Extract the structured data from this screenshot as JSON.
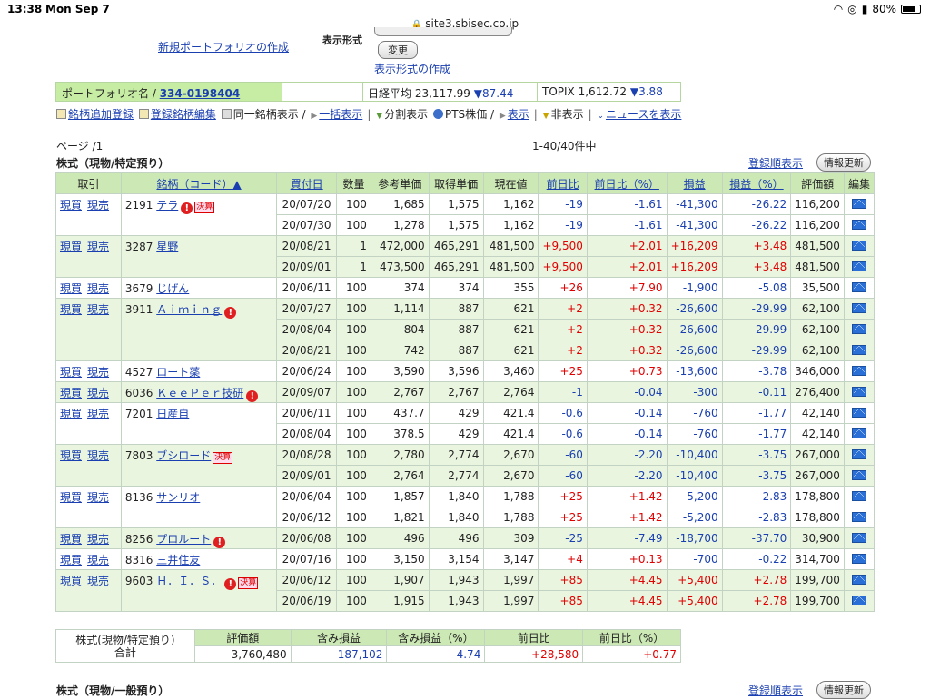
{
  "status": {
    "time": "13:38",
    "date": "Mon Sep 7",
    "battery": "80%",
    "url": "site3.sbisec.co.jp"
  },
  "top": {
    "new_portfolio": "新規ポートフォリオの作成",
    "display_format_label": "表示形式",
    "change_button": "変更",
    "create_format": "表示形式の作成"
  },
  "portfolio": {
    "label": "ポートフォリオ名 /",
    "id": "334-0198404",
    "nikkei_label": "日経平均",
    "nikkei_value": "23,117.99",
    "nikkei_change": "▼87.44",
    "topix_label": "TOPIX",
    "topix_value": "1,612.72",
    "topix_change": "▼3.88"
  },
  "links": {
    "add": "銘柄追加登録",
    "edit": "登録銘柄編集",
    "same_one": "同一銘柄表示 /",
    "bulk": "一括表示",
    "split": "分割表示",
    "pts": "PTS株価 /",
    "show": "表示",
    "hide": "非表示",
    "news": "ニュースを表示"
  },
  "page": {
    "label": "ページ /1",
    "count": "1-40/40件中"
  },
  "section1": {
    "title": "株式（現物/特定預り）",
    "order_link": "登録順表示",
    "refresh": "情報更新"
  },
  "section2": {
    "title": "株式（現物/一般預り）",
    "order_link": "登録順表示",
    "refresh": "情報更新"
  },
  "table": {
    "headers": [
      "取引",
      "銘柄（コード）▲",
      "買付日",
      "数量",
      "参考単価",
      "取得単価",
      "現在値",
      "前日比",
      "前日比（%）",
      "損益",
      "損益（%）",
      "評価額",
      "編集"
    ],
    "buy": "現買",
    "sell": "現売",
    "rows": [
      {
        "code": "2191",
        "name": "テラ",
        "warn": true,
        "kessan": true,
        "lots": [
          [
            "20/07/20",
            "100",
            "1,685",
            "1,575",
            "1,162",
            "-19",
            "-1.61",
            "-41,300",
            "-26.22",
            "116,200"
          ],
          [
            "20/07/30",
            "100",
            "1,278",
            "1,575",
            "1,162",
            "-19",
            "-1.61",
            "-41,300",
            "-26.22",
            "116,200"
          ]
        ]
      },
      {
        "code": "3287",
        "name": "星野",
        "warn": false,
        "kessan": false,
        "lots": [
          [
            "20/08/21",
            "1",
            "472,000",
            "465,291",
            "481,500",
            "+9,500",
            "+2.01",
            "+16,209",
            "+3.48",
            "481,500"
          ],
          [
            "20/09/01",
            "1",
            "473,500",
            "465,291",
            "481,500",
            "+9,500",
            "+2.01",
            "+16,209",
            "+3.48",
            "481,500"
          ]
        ]
      },
      {
        "code": "3679",
        "name": "じげん",
        "warn": false,
        "kessan": false,
        "lots": [
          [
            "20/06/11",
            "100",
            "374",
            "374",
            "355",
            "+26",
            "+7.90",
            "-1,900",
            "-5.08",
            "35,500"
          ]
        ]
      },
      {
        "code": "3911",
        "name": "Ａｉｍｉｎｇ",
        "warn": true,
        "kessan": false,
        "lots": [
          [
            "20/07/27",
            "100",
            "1,114",
            "887",
            "621",
            "+2",
            "+0.32",
            "-26,600",
            "-29.99",
            "62,100"
          ],
          [
            "20/08/04",
            "100",
            "804",
            "887",
            "621",
            "+2",
            "+0.32",
            "-26,600",
            "-29.99",
            "62,100"
          ],
          [
            "20/08/21",
            "100",
            "742",
            "887",
            "621",
            "+2",
            "+0.32",
            "-26,600",
            "-29.99",
            "62,100"
          ]
        ]
      },
      {
        "code": "4527",
        "name": "ロート薬",
        "warn": false,
        "kessan": false,
        "lots": [
          [
            "20/06/24",
            "100",
            "3,590",
            "3,596",
            "3,460",
            "+25",
            "+0.73",
            "-13,600",
            "-3.78",
            "346,000"
          ]
        ]
      },
      {
        "code": "6036",
        "name": "ＫｅｅＰｅｒ技研",
        "warn": true,
        "kessan": false,
        "lots": [
          [
            "20/09/07",
            "100",
            "2,767",
            "2,767",
            "2,764",
            "-1",
            "-0.04",
            "-300",
            "-0.11",
            "276,400"
          ]
        ]
      },
      {
        "code": "7201",
        "name": "日産自",
        "warn": false,
        "kessan": false,
        "lots": [
          [
            "20/06/11",
            "100",
            "437.7",
            "429",
            "421.4",
            "-0.6",
            "-0.14",
            "-760",
            "-1.77",
            "42,140"
          ],
          [
            "20/08/04",
            "100",
            "378.5",
            "429",
            "421.4",
            "-0.6",
            "-0.14",
            "-760",
            "-1.77",
            "42,140"
          ]
        ]
      },
      {
        "code": "7803",
        "name": "ブシロード",
        "warn": false,
        "kessan": true,
        "lots": [
          [
            "20/08/28",
            "100",
            "2,780",
            "2,774",
            "2,670",
            "-60",
            "-2.20",
            "-10,400",
            "-3.75",
            "267,000"
          ],
          [
            "20/09/01",
            "100",
            "2,764",
            "2,774",
            "2,670",
            "-60",
            "-2.20",
            "-10,400",
            "-3.75",
            "267,000"
          ]
        ]
      },
      {
        "code": "8136",
        "name": "サンリオ",
        "warn": false,
        "kessan": false,
        "lots": [
          [
            "20/06/04",
            "100",
            "1,857",
            "1,840",
            "1,788",
            "+25",
            "+1.42",
            "-5,200",
            "-2.83",
            "178,800"
          ],
          [
            "20/06/12",
            "100",
            "1,821",
            "1,840",
            "1,788",
            "+25",
            "+1.42",
            "-5,200",
            "-2.83",
            "178,800"
          ]
        ]
      },
      {
        "code": "8256",
        "name": "プロルート",
        "warn": true,
        "kessan": false,
        "lots": [
          [
            "20/06/08",
            "100",
            "496",
            "496",
            "309",
            "-25",
            "-7.49",
            "-18,700",
            "-37.70",
            "30,900"
          ]
        ]
      },
      {
        "code": "8316",
        "name": "三井住友",
        "warn": false,
        "kessan": false,
        "lots": [
          [
            "20/07/16",
            "100",
            "3,150",
            "3,154",
            "3,147",
            "+4",
            "+0.13",
            "-700",
            "-0.22",
            "314,700"
          ]
        ]
      },
      {
        "code": "9603",
        "name": "Ｈ．Ｉ．Ｓ．",
        "warn": true,
        "kessan": true,
        "lots": [
          [
            "20/06/12",
            "100",
            "1,907",
            "1,943",
            "1,997",
            "+85",
            "+4.45",
            "+5,400",
            "+2.78",
            "199,700"
          ],
          [
            "20/06/19",
            "100",
            "1,915",
            "1,943",
            "1,997",
            "+85",
            "+4.45",
            "+5,400",
            "+2.78",
            "199,700"
          ]
        ]
      }
    ],
    "kessan_label": "決算"
  },
  "summary": {
    "label_line1": "株式(現物/特定預り)",
    "label_line2": "合計",
    "headers": [
      "評価額",
      "含み損益",
      "含み損益（%）",
      "前日比",
      "前日比（%）"
    ],
    "values": [
      "3,760,480",
      "-187,102",
      "-4.74",
      "+28,580",
      "+0.77"
    ]
  }
}
